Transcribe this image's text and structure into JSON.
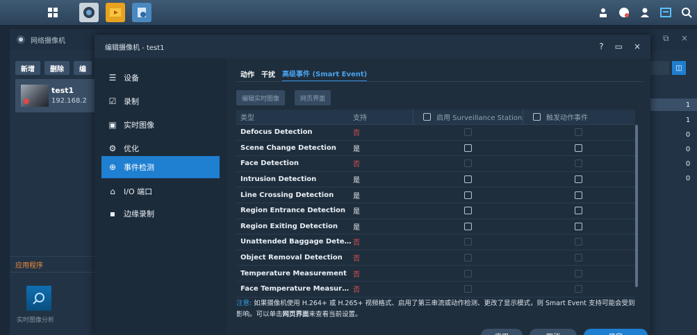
{
  "colors": {
    "accent": "#1f7fd0",
    "danger": "#e05252",
    "warn": "#2f9be0"
  },
  "taskbar": {
    "icons": [
      "grid-menu-icon",
      "surveillance-icon",
      "film-icon",
      "camera-app-icon"
    ],
    "right_icons": [
      "user-download-icon",
      "chat-icon",
      "user-icon",
      "widget-icon",
      "search-icon"
    ]
  },
  "bg_window": {
    "title": "网络摄像机",
    "buttons": [
      "新增",
      "删除",
      "编"
    ],
    "camera": {
      "name": "test1",
      "ip": "192.168.2"
    },
    "apps_label": "应用程序",
    "app_tile_label": "实时图像分析",
    "counts": [
      "1",
      "1",
      "0",
      "0",
      "0",
      "0"
    ]
  },
  "dialog": {
    "title": "编辑摄像机 - test1",
    "controls": {
      "help": "?",
      "maximize": "▭",
      "close": "×"
    },
    "nav": [
      {
        "label": "设备",
        "icon": "list-icon"
      },
      {
        "label": "录制",
        "icon": "record-icon"
      },
      {
        "label": "实时图像",
        "icon": "monitor-icon"
      },
      {
        "label": "优化",
        "icon": "gear-icon"
      },
      {
        "label": "事件检测",
        "icon": "target-icon",
        "active": true
      },
      {
        "label": "I/O 端口",
        "icon": "io-icon"
      },
      {
        "label": "边缘录制",
        "icon": "sd-icon"
      }
    ],
    "tabs": [
      "动作",
      "干扰",
      "高级事件 (Smart Event)"
    ],
    "action_buttons": [
      "编辑实时图像",
      "网页界面"
    ],
    "table": {
      "headers": [
        "类型",
        "支持",
        "启用 Surveillance Station",
        "触发动作事件"
      ],
      "rows": [
        {
          "type": "Defocus Detection",
          "support": "否",
          "ok": false
        },
        {
          "type": "Scene Change Detection",
          "support": "是",
          "ok": true
        },
        {
          "type": "Face Detection",
          "support": "否",
          "ok": false
        },
        {
          "type": "Intrusion Detection",
          "support": "是",
          "ok": true
        },
        {
          "type": "Line Crossing Detection",
          "support": "是",
          "ok": true
        },
        {
          "type": "Region Entrance Detection",
          "support": "是",
          "ok": true
        },
        {
          "type": "Region Exiting Detection",
          "support": "是",
          "ok": true
        },
        {
          "type": "Unattended Baggage Detecti...",
          "support": "否",
          "ok": false
        },
        {
          "type": "Object Removal Detection",
          "support": "否",
          "ok": false
        },
        {
          "type": "Temperature Measurement",
          "support": "否",
          "ok": false
        },
        {
          "type": "Face Temperature Measurem",
          "support": "否",
          "ok": false
        }
      ]
    },
    "note": {
      "prefix": "注意:",
      "text1": " 如果摄像机使用 H.264+ 或 H.265+ 视频格式、启用了第三串流或动作检测、更改了显示模式，则 Smart Event 支持可能会受到影响。可以单击",
      "link": "网页界面",
      "text2": "来查看当前设置。"
    },
    "footer": [
      "应用",
      "取消",
      "确定"
    ]
  }
}
